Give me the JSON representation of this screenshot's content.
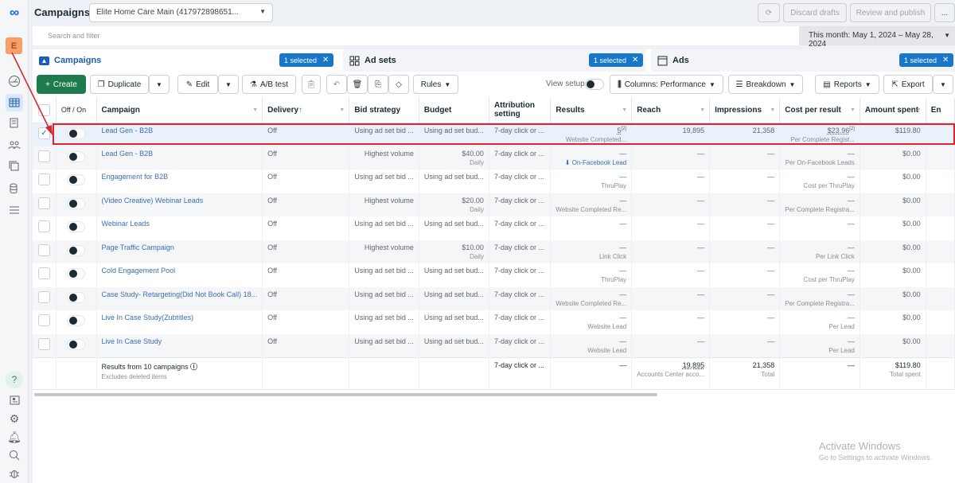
{
  "app": {
    "title": "Campaigns",
    "account": "Elite Home Care Main (417972898651..."
  },
  "header_buttons": {
    "refresh": "refresh",
    "discard": "Discard drafts",
    "review": "Review and publish",
    "more": "..."
  },
  "search": {
    "placeholder": "Search and filter"
  },
  "date_range": "This month: May 1, 2024 – May 28, 2024",
  "sidebar": {
    "avatar_letter": "E"
  },
  "tabs": [
    {
      "label": "Campaigns",
      "badge": "1 selected"
    },
    {
      "label": "Ad sets",
      "badge": "1 selected"
    },
    {
      "label": "Ads",
      "badge": "1 selected"
    }
  ],
  "toolbar": {
    "create": "Create",
    "duplicate": "Duplicate",
    "edit": "Edit",
    "ab_test": "A/B test",
    "rules": "Rules",
    "view_setup": "View setup",
    "columns": "Columns: Performance",
    "breakdown": "Breakdown",
    "reports": "Reports",
    "export": "Export"
  },
  "table": {
    "headers": [
      "Off / On",
      "Campaign",
      "Delivery",
      "Bid strategy",
      "Budget",
      "Attribution setting",
      "Results",
      "Reach",
      "Impressions",
      "Cost per result",
      "Amount spent",
      "En"
    ],
    "rows": [
      {
        "selected": true,
        "campaign": "Lead Gen - B2B",
        "delivery": "Off",
        "bid": "Using ad set bid ...",
        "budget": "Using ad set bud...",
        "budget_sub": "",
        "attribution": "7-day click or ...",
        "results": "5",
        "results_sub": "Website Completed...",
        "reach": "19,895",
        "impressions": "21,358",
        "cpr": "$23.96",
        "cpr_sub": "Per Complete Regist...",
        "spent": "$119.80"
      },
      {
        "selected": false,
        "campaign": "Lead Gen - B2B",
        "delivery": "Off",
        "bid": "Highest volume",
        "budget": "$40.00",
        "budget_sub": "Daily",
        "attribution": "7-day click or ...",
        "results": "—",
        "results_sub": "⬇ On-Facebook Lead",
        "reach": "—",
        "impressions": "—",
        "cpr": "—",
        "cpr_sub": "Per On-Facebook Leads",
        "spent": "$0.00"
      },
      {
        "selected": false,
        "campaign": "Engagement for B2B",
        "delivery": "Off",
        "bid": "Using ad set bid ...",
        "budget": "Using ad set bud...",
        "budget_sub": "",
        "attribution": "7-day click or ...",
        "results": "—",
        "results_sub": "ThruPlay",
        "reach": "—",
        "impressions": "—",
        "cpr": "—",
        "cpr_sub": "Cost per ThruPlay",
        "spent": "$0.00"
      },
      {
        "selected": false,
        "campaign": "(Video Creative) Webinar Leads",
        "delivery": "Off",
        "bid": "Highest volume",
        "budget": "$20.00",
        "budget_sub": "Daily",
        "attribution": "7-day click or ...",
        "results": "—",
        "results_sub": "Website Completed Re...",
        "reach": "—",
        "impressions": "—",
        "cpr": "—",
        "cpr_sub": "Per Complete Registra...",
        "spent": "$0.00"
      },
      {
        "selected": false,
        "campaign": "Webinar Leads",
        "delivery": "Off",
        "bid": "Using ad set bid ...",
        "budget": "Using ad set bud...",
        "budget_sub": "",
        "attribution": "7-day click or ...",
        "results": "—",
        "results_sub": "",
        "reach": "—",
        "impressions": "—",
        "cpr": "—",
        "cpr_sub": "",
        "spent": "$0.00"
      },
      {
        "selected": false,
        "campaign": "Page Traffic Campaign",
        "delivery": "Off",
        "bid": "Highest volume",
        "budget": "$10.00",
        "budget_sub": "Daily",
        "attribution": "7-day click or ...",
        "results": "—",
        "results_sub": "Link Click",
        "reach": "—",
        "impressions": "—",
        "cpr": "—",
        "cpr_sub": "Per Link Click",
        "spent": "$0.00"
      },
      {
        "selected": false,
        "campaign": "Cold Engagement Pool",
        "delivery": "Off",
        "bid": "Using ad set bid ...",
        "budget": "Using ad set bud...",
        "budget_sub": "",
        "attribution": "7-day click or ...",
        "results": "—",
        "results_sub": "ThruPlay",
        "reach": "—",
        "impressions": "—",
        "cpr": "—",
        "cpr_sub": "Cost per ThruPlay",
        "spent": "$0.00"
      },
      {
        "selected": false,
        "campaign": "Case Study- Retargeting(Did Not Book Call) 18...",
        "delivery": "Off",
        "bid": "Using ad set bid ...",
        "budget": "Using ad set bud...",
        "budget_sub": "",
        "attribution": "7-day click or ...",
        "results": "—",
        "results_sub": "Website Completed Re...",
        "reach": "—",
        "impressions": "—",
        "cpr": "—",
        "cpr_sub": "Per Complete Registra...",
        "spent": "$0.00"
      },
      {
        "selected": false,
        "campaign": "Live In Case Study(Zubtitles)",
        "delivery": "Off",
        "bid": "Using ad set bid ...",
        "budget": "Using ad set bud...",
        "budget_sub": "",
        "attribution": "7-day click or ...",
        "results": "—",
        "results_sub": "Website Lead",
        "reach": "—",
        "impressions": "—",
        "cpr": "—",
        "cpr_sub": "Per Lead",
        "spent": "$0.00"
      },
      {
        "selected": false,
        "campaign": "Live In Case Study",
        "delivery": "Off",
        "bid": "Using ad set bid ...",
        "budget": "Using ad set bud...",
        "budget_sub": "",
        "attribution": "7-day click or ...",
        "results": "—",
        "results_sub": "Website Lead",
        "reach": "—",
        "impressions": "—",
        "cpr": "—",
        "cpr_sub": "Per Lead",
        "spent": "$0.00"
      }
    ],
    "footer": {
      "label": "Results from 10 campaigns",
      "label_sub": "Excludes deleted items",
      "attribution": "7-day click or ...",
      "results": "—",
      "reach": "19,895",
      "reach_sub": "Accounts Center acco...",
      "impressions": "21,358",
      "impressions_sub": "Total",
      "cpr": "—",
      "spent": "$119.80",
      "spent_sub": "Total spent"
    }
  },
  "watermark": {
    "line1": "Activate Windows",
    "line2": "Go to Settings to activate Windows."
  },
  "colors": {
    "accent": "#1877c9",
    "create": "#1f7a4d",
    "annotation": "#d9262f"
  }
}
